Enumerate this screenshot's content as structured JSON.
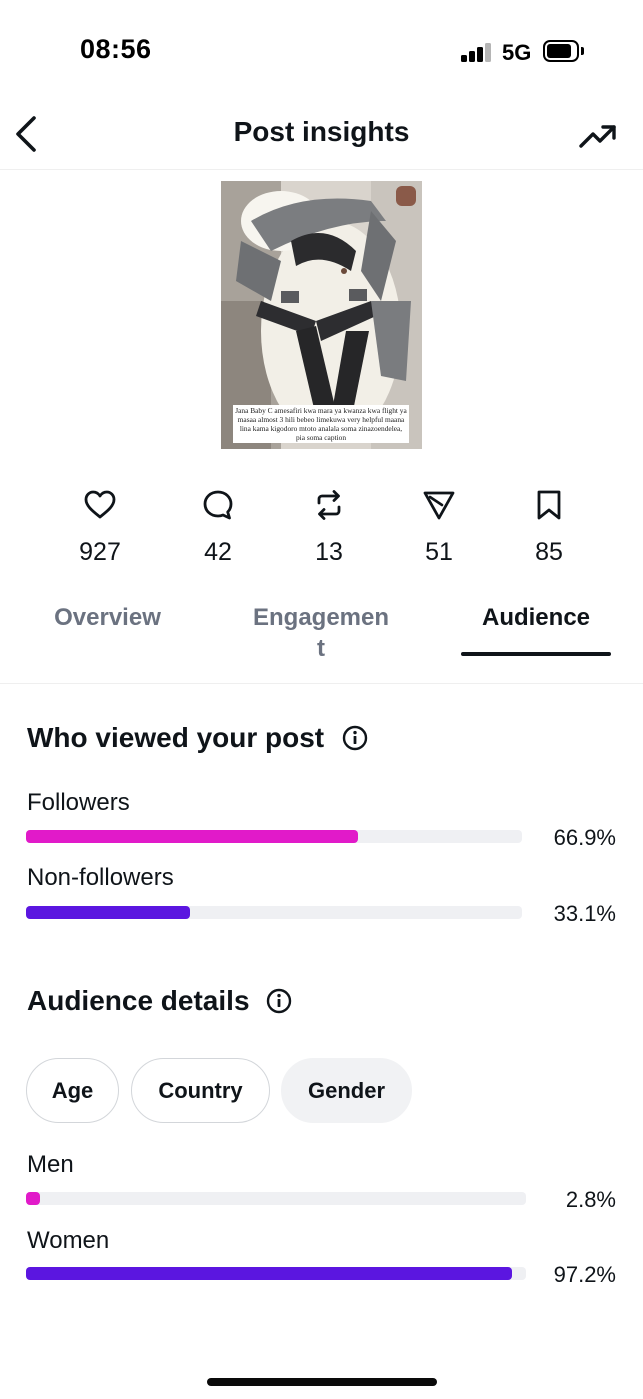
{
  "status_bar": {
    "time": "08:56",
    "network": "5G"
  },
  "nav": {
    "title": "Post insights"
  },
  "post": {
    "caption": "Jana Baby C amesafiri kwa mara ya kwanza kwa flight ya masaa almost 3 hili bebeo limekuwa very helpful maana lina kama kigodoro mtoto analala soma zinazoendelea, pia soma caption"
  },
  "metrics": {
    "likes": "927",
    "replies": "42",
    "reposts": "13",
    "shares": "51",
    "bookmarks": "85"
  },
  "tabs": {
    "overview": "Overview",
    "engagement_line1": "Engagemen",
    "engagement_line2": "t",
    "audience": "Audience",
    "active": "audience"
  },
  "viewers": {
    "title": "Who viewed your post",
    "followers": {
      "label": "Followers",
      "percent": "66.9%",
      "value": 0.669,
      "color": "#e11ac9"
    },
    "non_followers": {
      "label": "Non-followers",
      "percent": "33.1%",
      "value": 0.331,
      "color": "#5b16e0"
    }
  },
  "audience_details": {
    "title": "Audience details",
    "filters": [
      "Age",
      "Country",
      "Gender"
    ],
    "selected_filter": "Gender",
    "men": {
      "label": "Men",
      "percent": "2.8%",
      "value": 0.028,
      "color": "#e11ac9"
    },
    "women": {
      "label": "Women",
      "percent": "97.2%",
      "value": 0.972,
      "color": "#5b16e0"
    }
  },
  "icons": [
    "back-icon",
    "trend-icon",
    "heart-icon",
    "reply-icon",
    "repost-icon",
    "share-icon",
    "bookmark-icon",
    "info-icon"
  ]
}
